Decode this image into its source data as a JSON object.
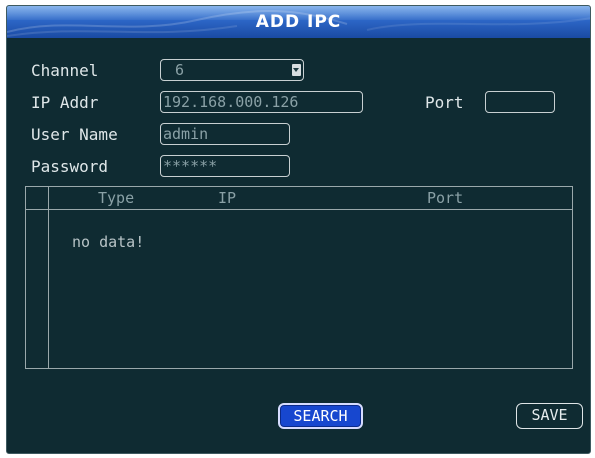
{
  "dialog": {
    "title": "ADD IPC"
  },
  "form": {
    "channel": {
      "label": "Channel",
      "value": "6"
    },
    "ip_addr": {
      "label": "IP Addr",
      "value": "192.168.000.126"
    },
    "port": {
      "label": "Port",
      "value": ""
    },
    "user_name": {
      "label": "User Name",
      "value": "admin"
    },
    "password": {
      "label": "Password",
      "value": "******"
    }
  },
  "results_table": {
    "columns": [
      "Type",
      "IP",
      "Port"
    ],
    "empty_message": "no data!"
  },
  "buttons": {
    "search_label": "SEARCH",
    "save_label": "SAVE"
  },
  "colors": {
    "background": "#0f2b32",
    "title_bar": "#2c66c6",
    "search_button": "#1747cf"
  }
}
